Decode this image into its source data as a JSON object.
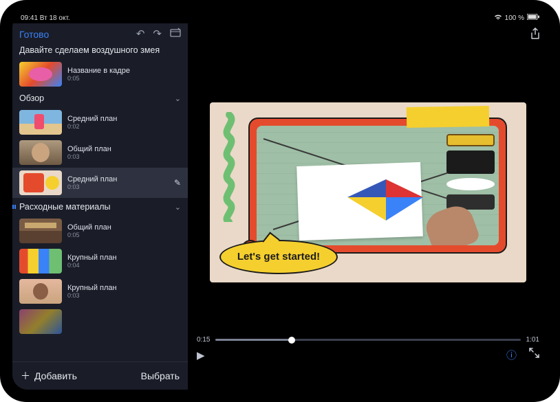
{
  "statusbar": {
    "time_date": "09:41  Вт 18 окт.",
    "battery": "100 %"
  },
  "toolbar": {
    "done": "Готово"
  },
  "project_title": "Давайте сделаем воздушного змея",
  "intro_clip": {
    "label": "Название в кадре",
    "duration": "0:05"
  },
  "sections": [
    {
      "title": "Обзор",
      "clips": [
        {
          "label": "Средний план",
          "duration": "0:02",
          "thumb": "th-beach",
          "selected": false
        },
        {
          "label": "Общий план",
          "duration": "0:03",
          "thumb": "th-portrait",
          "selected": false
        },
        {
          "label": "Средний план",
          "duration": "0:03",
          "thumb": "th-collage",
          "selected": true
        }
      ]
    },
    {
      "title": "Расходные материалы",
      "clips": [
        {
          "label": "Общий план",
          "duration": "0:05",
          "thumb": "th-shelf"
        },
        {
          "label": "Крупный план",
          "duration": "0:04",
          "thumb": "th-craft"
        },
        {
          "label": "Крупный план",
          "duration": "0:03",
          "thumb": "th-person"
        }
      ]
    }
  ],
  "bottom": {
    "add": "Добавить",
    "select": "Выбрать"
  },
  "preview": {
    "bubble_text": "Let's get started!",
    "time_current": "0:15",
    "time_total": "1:01"
  }
}
